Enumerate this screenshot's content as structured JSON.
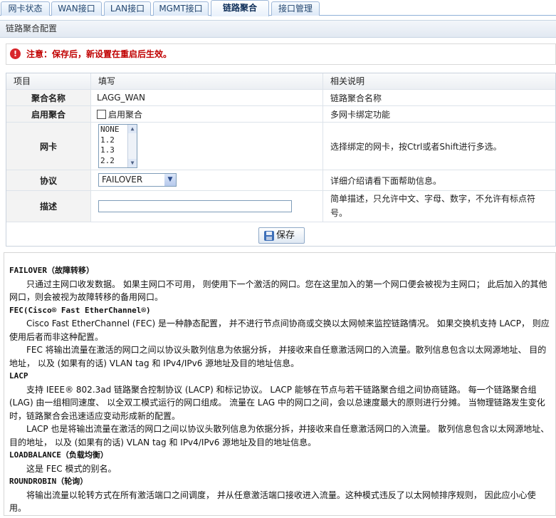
{
  "tabs": [
    {
      "label": "网卡状态",
      "active": false
    },
    {
      "label": "WAN接口",
      "active": false
    },
    {
      "label": "LAN接口",
      "active": false
    },
    {
      "label": "MGMT接口",
      "active": false
    },
    {
      "label": "链路聚合",
      "active": true
    },
    {
      "label": "接口管理",
      "active": false
    }
  ],
  "section_title": "链路聚合配置",
  "notice": "注意：保存后，新设置在重启后生效。",
  "table": {
    "headers": [
      "项目",
      "填写",
      "相关说明"
    ],
    "rows": {
      "name": {
        "label": "聚合名称",
        "value": "LAGG_WAN",
        "desc": "链路聚合名称"
      },
      "enable": {
        "label": "启用聚合",
        "checkbox_label": "启用聚合",
        "checked": false,
        "desc": "多网卡绑定功能"
      },
      "nic": {
        "label": "网卡",
        "options": [
          "NONE",
          "1.2",
          "1.3",
          "2.2"
        ],
        "desc": "选择绑定的网卡，按Ctrl或者Shift进行多选。"
      },
      "protocol": {
        "label": "协议",
        "value": "FAILOVER",
        "desc": "详细介绍请看下面帮助信息。"
      },
      "description": {
        "label": "描述",
        "value": "",
        "desc": "简单描述，只允许中文、字母、数字，不允许有标点符号。"
      }
    }
  },
  "save_label": "保存",
  "help": {
    "failover_title": "FAILOVER（故障转移）",
    "failover_p1": "只通过主网口收发数据。 如果主网口不可用， 则使用下一个激活的网口。您在这里加入的第一个网口便会被视为主网口； 此后加入的其他网口，则会被视为故障转移的备用网口。",
    "fec_title": "FEC(Cisco® Fast EtherChannel®)",
    "fec_p1": "Cisco Fast EtherChannel (FEC) 是一种静态配置， 并不进行节点间协商或交换以太网帧来监控链路情况。 如果交换机支持 LACP， 则应使用后者而非这种配置。",
    "fec_p2": "FEC 将输出流量在激活的网口之间以协议头散列信息为依据分拆， 并接收来自任意激活网口的入流量。散列信息包含以太网源地址、 目的地址， 以及 (如果有的话) VLAN tag 和 IPv4/IPv6 源地址及目的地址信息。",
    "lacp_title": "LACP",
    "lacp_p1": "支持 IEEE® 802.3ad 链路聚合控制协议 (LACP) 和标记协议。 LACP 能够在节点与若干链路聚合组之间协商链路。 每一个链路聚合组 (LAG) 由一组相同速度、 以全双工模式运行的网口组成。 流量在 LAG 中的网口之间，会以总速度最大的原则进行分摊。 当物理链路发生变化时，链路聚合会迅速适应变动形成新的配置。",
    "lacp_p2": "LACP 也是将输出流量在激活的网口之间以协议头散列信息为依据分拆，并接收来自任意激活网口的入流量。 散列信息包含以太网源地址、目的地址， 以及 (如果有的话) VLAN tag 和 IPv4/IPv6 源地址及目的地址信息。",
    "loadbalance_title": "LOADBALANCE（负载均衡）",
    "loadbalance_p1": "这是 FEC 模式的别名。",
    "roundrobin_title": "ROUNDROBIN（轮询）",
    "roundrobin_p1": "将输出流量以轮转方式在所有激活端口之间调度， 并从任意激活端口接收进入流量。这种模式违反了以太网帧排序规则， 因此应小心使用。"
  }
}
